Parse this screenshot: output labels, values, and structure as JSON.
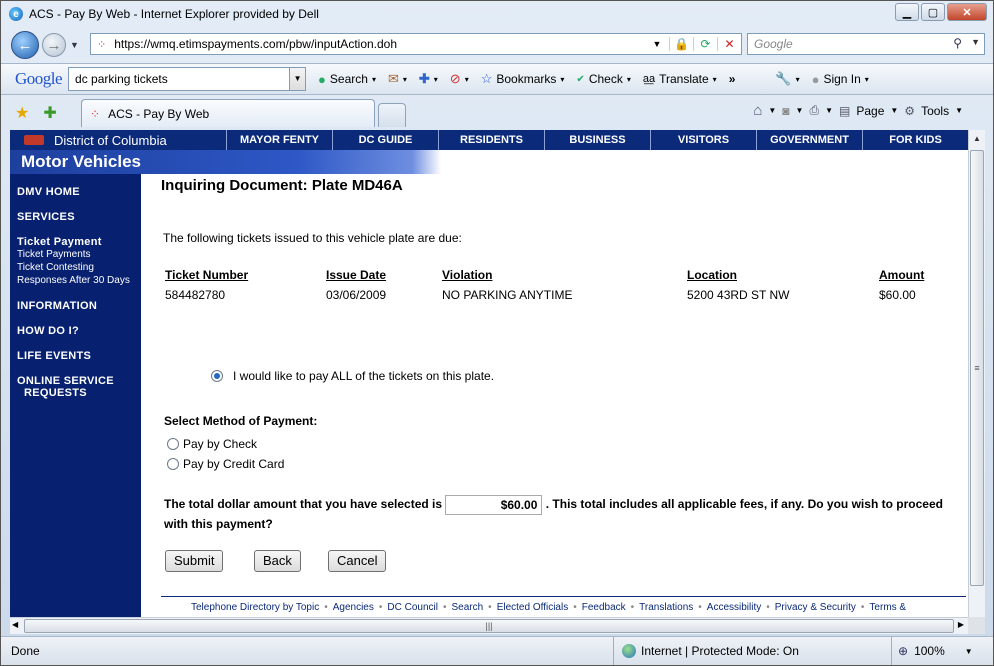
{
  "window": {
    "title": "ACS - Pay By Web - Internet Explorer provided by Dell"
  },
  "browser": {
    "url": "https://wmq.etimspayments.com/pbw/inputAction.doh",
    "search_placeholder": "Google",
    "google_toolbar": {
      "logo": "Google",
      "query": "dc parking tickets",
      "search_label": "Search",
      "bookmarks_label": "Bookmarks",
      "check_label": "Check",
      "translate_label": "Translate",
      "more_label": "»",
      "signin_label": "Sign In"
    },
    "tab_title": "ACS - Pay By Web",
    "page_label": "Page",
    "tools_label": "Tools",
    "status": {
      "text": "Done",
      "zone": "Internet | Protected Mode: On",
      "zoom": "100%"
    }
  },
  "site": {
    "dc_label": "District of Columbia",
    "nav": [
      "MAYOR FENTY",
      "DC GUIDE",
      "RESIDENTS",
      "BUSINESS",
      "VISITORS",
      "GOVERNMENT",
      "FOR KIDS"
    ],
    "section_title": "Motor Vehicles",
    "sidebar": {
      "dmv_home": "DMV HOME",
      "services": "SERVICES",
      "ticket_payment": "Ticket Payment",
      "ticket_payments": "Ticket Payments",
      "ticket_contesting": "Ticket Contesting",
      "responses": "Responses After 30 Days",
      "information": "INFORMATION",
      "how_do_i": "HOW DO I?",
      "life_events": "LIFE EVENTS",
      "online_1": "ONLINE SERVICE",
      "online_2": "REQUESTS"
    }
  },
  "main": {
    "heading": "Inquiring Document: Plate MD46A",
    "intro": "The following tickets issued to this vehicle plate are due:",
    "columns": [
      "Ticket Number",
      "Issue Date",
      "Violation",
      "Location",
      "Amount"
    ],
    "rows": [
      [
        "584482780",
        "03/06/2009",
        "NO PARKING ANYTIME",
        "5200 43RD ST NW",
        "$60.00"
      ]
    ],
    "pay_all": "I would like to pay ALL of the tickets on this plate.",
    "method_label": "Select Method of Payment:",
    "options": [
      "Pay by Check",
      "Pay by Credit Card"
    ],
    "total_prefix": "The total dollar amount that you have selected is",
    "total_amount": "$60.00",
    "total_suffix": ". This total includes all applicable fees, if any. Do you wish to proceed with this payment?",
    "buttons": {
      "submit": "Submit",
      "back": "Back",
      "cancel": "Cancel"
    },
    "footer": [
      "Telephone Directory by Topic",
      "Agencies",
      "DC Council",
      "Search",
      "Elected Officials",
      "Feedback",
      "Translations",
      "Accessibility",
      "Privacy & Security",
      "Terms &"
    ]
  },
  "colors": {
    "dc_navy": "#0b2a7a",
    "sidebar": "#07206f",
    "accent_blue": "#2e58c6"
  }
}
